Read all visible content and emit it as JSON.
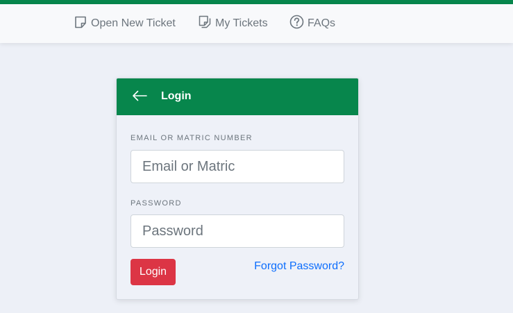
{
  "colors": {
    "brand_green": "#07864c",
    "page_bg": "#edf0f7",
    "danger": "#dc3545",
    "link": "#0d6efd"
  },
  "nav": {
    "items": [
      {
        "label": "Open New Ticket",
        "icon": "note-icon"
      },
      {
        "label": "My Tickets",
        "icon": "notes-stack-icon"
      },
      {
        "label": "FAQs",
        "icon": "question-circle-icon"
      }
    ]
  },
  "login_card": {
    "title": "Login",
    "back_icon": "arrow-left-icon",
    "email_label": "EMAIL OR MATRIC NUMBER",
    "email_placeholder": "Email or Matric",
    "email_value": "",
    "password_label": "PASSWORD",
    "password_placeholder": "Password",
    "password_value": "",
    "submit_label": "Login",
    "forgot_label": "Forgot Password?"
  }
}
